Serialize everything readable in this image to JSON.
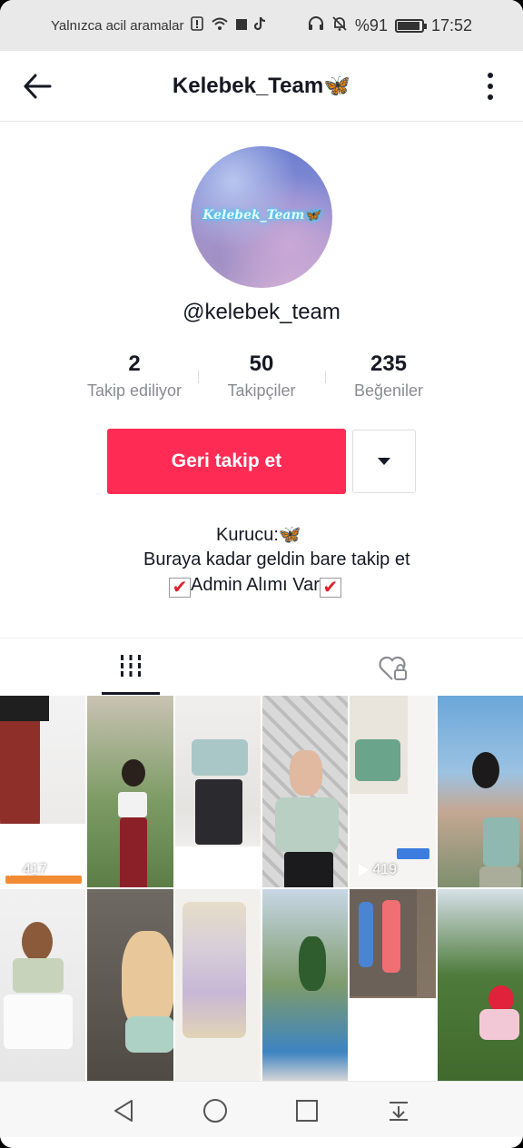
{
  "status_bar": {
    "carrier_text": "Yalnızca acil aramalar",
    "battery_percent": "%91",
    "battery_level": 0.91,
    "time": "17:52",
    "icons": [
      "sim-alert-icon",
      "wifi-icon",
      "square-icon",
      "tiktok-icon",
      "headphones-icon",
      "bell-off-icon",
      "battery-icon"
    ]
  },
  "header": {
    "title": "Kelebek_Team🦋",
    "back_icon": "arrow-left-icon",
    "more_icon": "more-vertical-icon"
  },
  "profile": {
    "avatar_text": "Kelebek_Team🦋",
    "username": "@kelebek_team"
  },
  "stats": [
    {
      "number": "2",
      "label": "Takip ediliyor"
    },
    {
      "number": "50",
      "label": "Takipçiler"
    },
    {
      "number": "235",
      "label": "Beğeniler"
    }
  ],
  "actions": {
    "follow_back_label": "Geri takip et",
    "dropdown_icon": "caret-down-icon"
  },
  "bio": {
    "line1": "Kurucu:🦋",
    "line2": "Buraya kadar geldin bare takip et",
    "line3": "Admin Alımı Var",
    "check_icon": "✔"
  },
  "tabs": {
    "videos_icon": "grid-bars-icon",
    "liked_icon": "heart-lock-icon"
  },
  "videos": [
    {
      "play_count": "417"
    },
    {
      "play_count": ""
    },
    {
      "play_count": ""
    },
    {
      "play_count": ""
    },
    {
      "play_count": "419"
    },
    {
      "play_count": ""
    },
    {
      "play_count": ""
    },
    {
      "play_count": ""
    },
    {
      "play_count": ""
    },
    {
      "play_count": ""
    },
    {
      "play_count": ""
    },
    {
      "play_count": ""
    }
  ],
  "nav_bar": {
    "icons": [
      "nav-back-icon",
      "nav-home-icon",
      "nav-recents-icon",
      "nav-notification-icon"
    ]
  }
}
